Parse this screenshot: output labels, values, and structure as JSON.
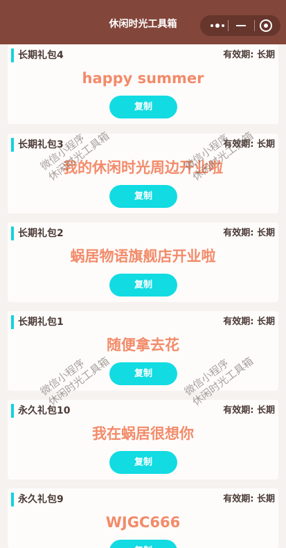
{
  "navbar": {
    "title": "休闲时光工具箱",
    "capsule": {
      "more_icon": "more-dots-icon",
      "minimize_icon": "minimize-icon",
      "close_icon": "target-close-icon"
    }
  },
  "watermark": {
    "line1": "微信小程序",
    "line2": "休闲时光工具箱"
  },
  "cards": [
    {
      "name": "长期礼包4",
      "validity": "有效期: 长期",
      "code": "happy summer",
      "button": "复制"
    },
    {
      "name": "长期礼包3",
      "validity": "有效期: 长期",
      "code": "我的休闲时光周边开业啦",
      "button": "复制"
    },
    {
      "name": "长期礼包2",
      "validity": "有效期: 长期",
      "code": "蜗居物语旗舰店开业啦",
      "button": "复制"
    },
    {
      "name": "长期礼包1",
      "validity": "有效期: 长期",
      "code": "随便拿去花",
      "button": "复制"
    },
    {
      "name": "永久礼包10",
      "validity": "有效期: 长期",
      "code": "我在蜗居很想你",
      "button": "复制"
    },
    {
      "name": "永久礼包9",
      "validity": "有效期: 长期",
      "code": "WJGC666",
      "button": "复制"
    }
  ],
  "colors": {
    "navbar": "#83463a",
    "accent": "#12d3dd",
    "code_text": "#f28b6a",
    "button": "#12dbe2"
  }
}
